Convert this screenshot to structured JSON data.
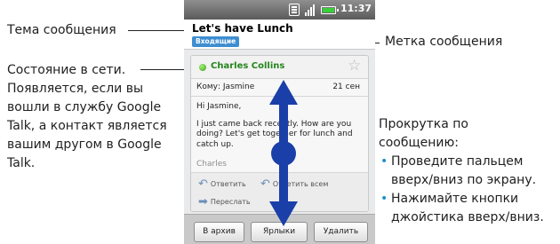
{
  "annotations": {
    "message_topic": "Тема сообщения",
    "message_label": "Метка сообщения",
    "online_status": [
      "Состояние в сети.",
      "Появляется, если вы",
      "вошли в службу Google",
      "Talk, а контакт является",
      "вашим другом в Google",
      "Talk."
    ],
    "scroll_title": [
      "Прокрутка по",
      "сообщению:"
    ],
    "scroll_tips": [
      [
        "Проведите пальцем",
        "вверх/вниз по экрану."
      ],
      [
        "Нажимайте кнопки",
        "джойстика вверх/вниз."
      ]
    ]
  },
  "status_bar": {
    "time": "11:37",
    "sim_icon": "sim-card-icon",
    "signal_icon": "signal-bars-icon",
    "battery_icon": "battery-icon",
    "battery_color": "#39d039"
  },
  "email": {
    "subject": "Let's have Lunch",
    "label": "Входящие",
    "label_color": "#3e8ed0",
    "sender": "Charles Collins",
    "sender_color": "#23861c",
    "presence_color": "#39a314",
    "star_icon": "star-outline-icon",
    "recipient": "Кому: Jasmine",
    "date": "21 сен",
    "greeting": "Hi Jasmine,",
    "body": "I just came back recently. How are you doing? Let's get together for lunch and catch up.",
    "signature": "Charles",
    "actions": {
      "reply": "Ответить",
      "reply_all": "Ответить всем",
      "forward": "Переслать"
    }
  },
  "bottom_buttons": {
    "archive": "В архив",
    "labels": "Ярлыки",
    "delete": "Удалить"
  },
  "scroll_indicator": {
    "icon": "double-arrow-scroll-icon",
    "color": "#1a3fa8"
  }
}
